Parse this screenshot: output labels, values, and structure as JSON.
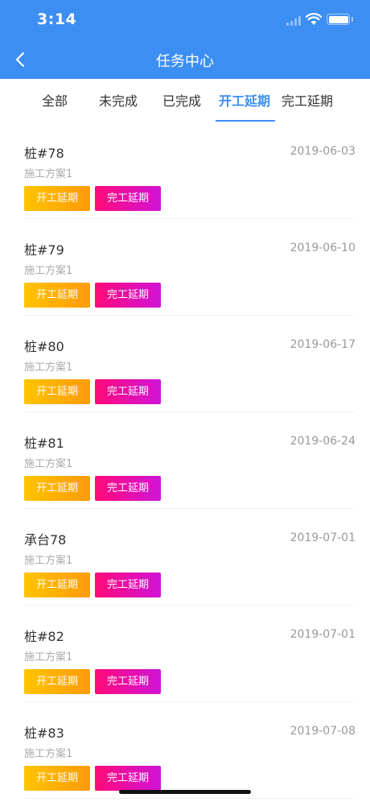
{
  "status_bar": {
    "time": "3:14"
  },
  "nav": {
    "title": "任务中心",
    "back_icon": "chevron-left-icon"
  },
  "tabs": [
    {
      "label": "全部",
      "active": false
    },
    {
      "label": "未完成",
      "active": false
    },
    {
      "label": "已完成",
      "active": false
    },
    {
      "label": "开工延期",
      "active": true
    },
    {
      "label": "完工延期",
      "active": false
    }
  ],
  "tags": {
    "start_delay": "开工延期",
    "finish_delay": "完工延期"
  },
  "items": [
    {
      "title": "桩#78",
      "subtitle": "施工方案1",
      "date": "2019-06-03"
    },
    {
      "title": "桩#79",
      "subtitle": "施工方案1",
      "date": "2019-06-10"
    },
    {
      "title": "桩#80",
      "subtitle": "施工方案1",
      "date": "2019-06-17"
    },
    {
      "title": "桩#81",
      "subtitle": "施工方案1",
      "date": "2019-06-24"
    },
    {
      "title": "承台78",
      "subtitle": "施工方案1",
      "date": "2019-07-01"
    },
    {
      "title": "桩#82",
      "subtitle": "施工方案1",
      "date": "2019-07-01"
    },
    {
      "title": "桩#83",
      "subtitle": "施工方案1",
      "date": "2019-07-08"
    }
  ],
  "colors": {
    "primary": "#3d8ef2",
    "tag_start_gradient": [
      "#ffc400",
      "#ff9a0a"
    ],
    "tag_finish_gradient": [
      "#ff0a78",
      "#cf14d8"
    ]
  }
}
